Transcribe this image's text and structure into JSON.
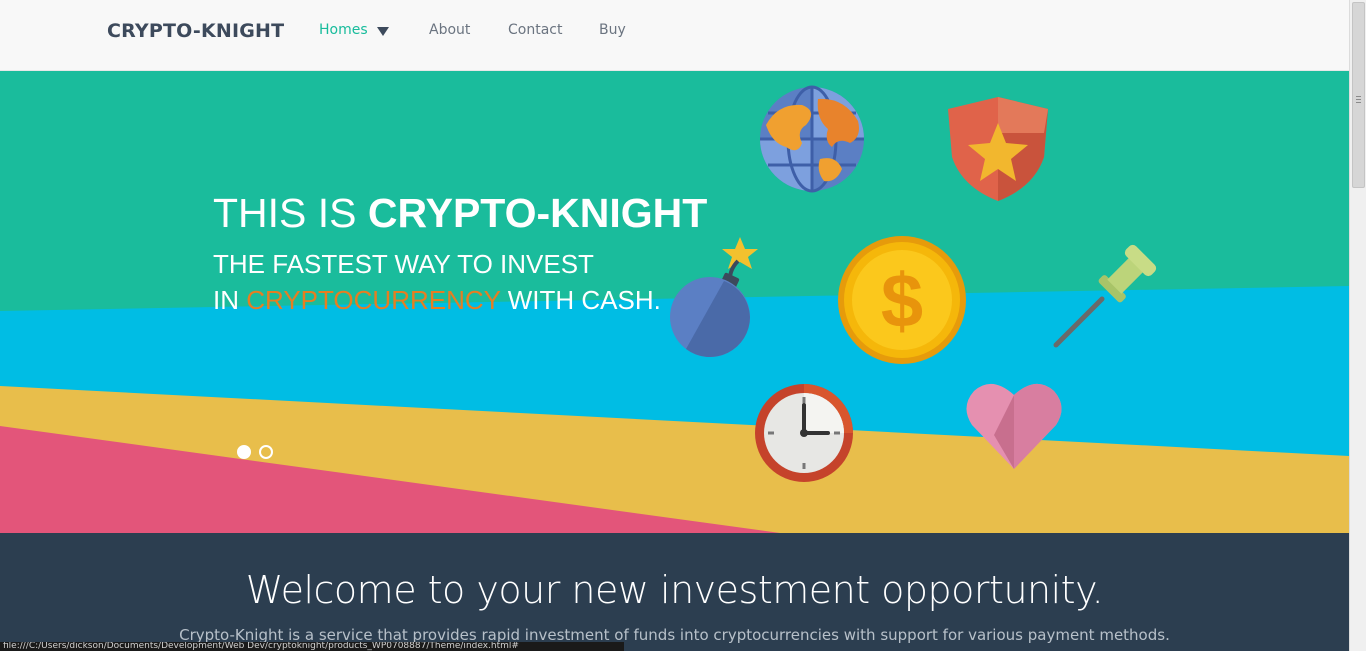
{
  "navbar": {
    "brand": "CRYPTO-KNIGHT",
    "items": [
      {
        "label": "Homes",
        "active": true,
        "has_dropdown": true
      },
      {
        "label": "About"
      },
      {
        "label": "Contact"
      },
      {
        "label": "Buy"
      }
    ]
  },
  "hero": {
    "title_prefix": "THIS IS ",
    "title_bold": "CRYPTO-KNIGHT",
    "line1": "THE FASTEST WAY TO INVEST",
    "line2_prefix": "IN ",
    "line2_accent": "CRYPTOCURRENCY",
    "line2_suffix": " WITH CASH.",
    "slides": {
      "count": 2,
      "active_index": 0
    },
    "icons": [
      "globe-icon",
      "shield-star-icon",
      "bomb-icon",
      "dollar-coin-icon",
      "pushpin-icon",
      "clock-icon",
      "heart-icon"
    ]
  },
  "welcome": {
    "title": "Welcome to your new investment opportunity.",
    "text": "Crypto-Knight is a service that provides rapid investment of funds into cryptocurrencies with support for various payment methods."
  },
  "statusbar": {
    "url": "file:///C:/Users/dickson/Documents/Development/Web Dev/cryptoknight/products_WP0708887/Theme/index.html#"
  },
  "colors": {
    "accent": "#18bc9c",
    "hero_green": "#1abc9c",
    "hero_blue": "#00bde4",
    "hero_yellow": "#e8be4b",
    "hero_pink": "#e3557a",
    "highlight_orange": "#e67e22",
    "dark": "#2c3e50"
  }
}
